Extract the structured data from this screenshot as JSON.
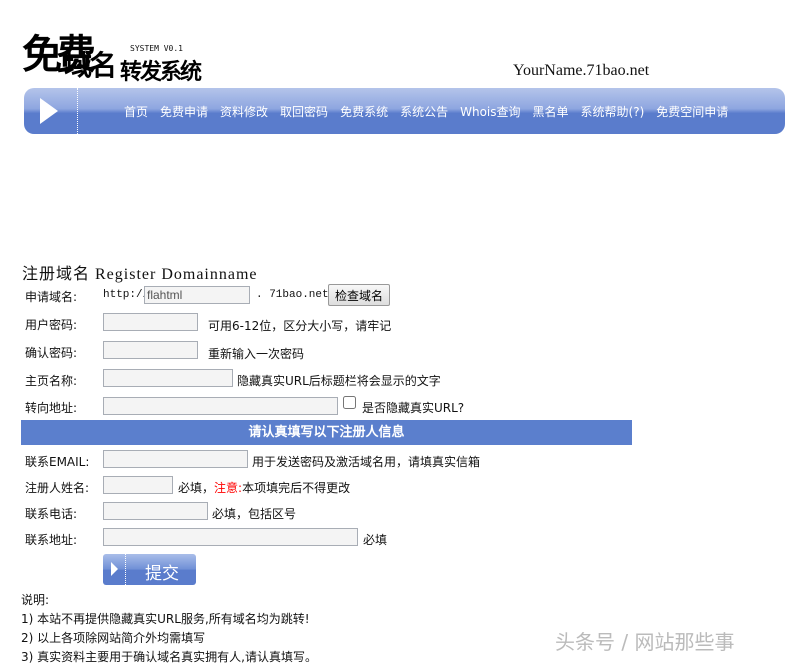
{
  "header": {
    "logo_line1": "免费",
    "logo_line2": "域名",
    "logo_line3": "转发系统",
    "logo_version": "SYSTEM V0.1",
    "domain": "YourName.71bao.net"
  },
  "nav": {
    "items": [
      "首页",
      "免费申请",
      "资料修改",
      "取回密码",
      "免费系统",
      "系统公告",
      "Whois查询",
      "黑名单",
      "系统帮助(?)",
      "免费空间申请"
    ]
  },
  "form": {
    "title": "注册域名 Register Domainname",
    "domain_label": "申请域名:",
    "domain_prefix": "http://",
    "domain_value": "flahtml",
    "domain_suffix": ". 71bao.net",
    "check_button": "检查域名",
    "password_label": "用户密码:",
    "password_hint": "可用6-12位，区分大小写，请牢记",
    "confirm_label": "确认密码:",
    "confirm_hint": "重新输入一次密码",
    "homepage_label": "主页名称:",
    "homepage_hint": "隐藏真实URL后标题栏将会显示的文字",
    "redirect_label": "转向地址:",
    "hide_url_label": "是否隐藏真实URL?",
    "section_title": "请认真填写以下注册人信息",
    "email_label": "联系EMAIL:",
    "email_hint": "用于发送密码及激活域名用，请填真实信箱",
    "name_label": "注册人姓名:",
    "name_hint1": "必填，",
    "name_hint_warn": "注意:",
    "name_hint2": "本项填完后不得更改",
    "phone_label": "联系电话:",
    "phone_hint": "必填，包括区号",
    "address_label": "联系地址:",
    "address_hint": "必填",
    "submit": "提交"
  },
  "notes": {
    "title": "说明:",
    "items": [
      "1) 本站不再提供隐藏真实URL服务,所有域名均为跳转!",
      "2) 以上各项除网站简介外均需填写",
      "3) 真实资料主要用于确认域名真实拥有人,请认真填写。"
    ]
  },
  "watermark": "头条号 / 网站那些事",
  "colors": {
    "accent": "#5b7fcd",
    "warning": "#ff0000"
  }
}
